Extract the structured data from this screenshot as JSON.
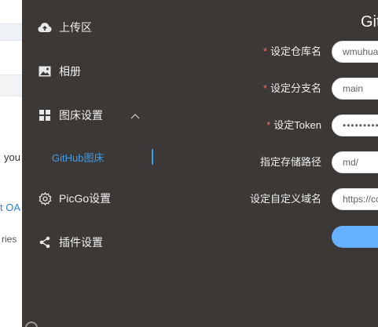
{
  "background_page": {
    "text_line_1": "you",
    "link_fragment": "t OA",
    "text_line_2": "ries"
  },
  "sidebar": {
    "items": [
      {
        "label": "上传区",
        "icon": "cloud-upload-icon"
      },
      {
        "label": "相册",
        "icon": "image-icon"
      },
      {
        "label": "图床设置",
        "icon": "grid-icon",
        "expanded": true
      },
      {
        "label": "PicGo设置",
        "icon": "gear-icon"
      },
      {
        "label": "插件设置",
        "icon": "share-icon"
      }
    ],
    "sub_item": {
      "label": "GitHub图床",
      "active": true
    }
  },
  "form": {
    "title": "Git",
    "fields": [
      {
        "label": "设定仓库名",
        "required": true,
        "value": "wmuhua"
      },
      {
        "label": "设定分支名",
        "required": true,
        "value": "main"
      },
      {
        "label": "设定Token",
        "required": true,
        "value": "••••••••••••"
      },
      {
        "label": "指定存储路径",
        "required": false,
        "value": "md/"
      },
      {
        "label": "设定自定义域名",
        "required": false,
        "value": "https://cc"
      }
    ],
    "required_mark": "*"
  },
  "colors": {
    "app_bg": "#3c3835",
    "accent": "#3f9ce8",
    "button": "#66b1ff",
    "required": "#f56c6c"
  }
}
